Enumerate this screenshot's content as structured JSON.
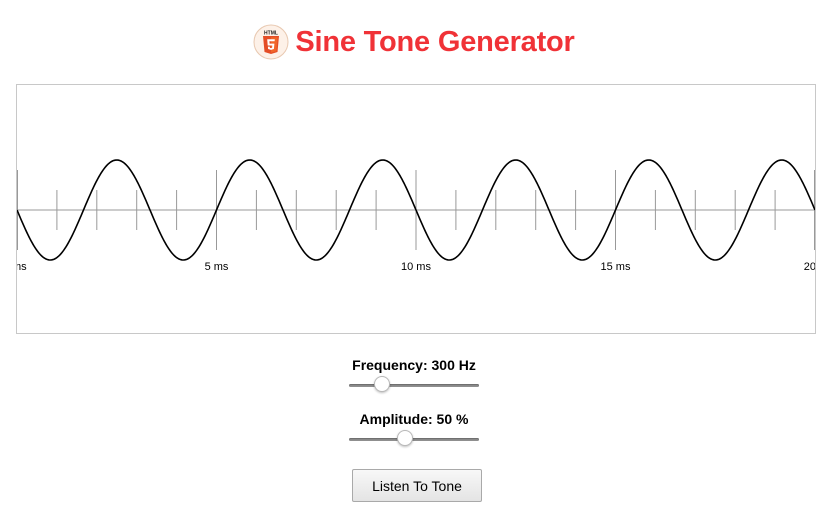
{
  "header": {
    "logo_icon": "html5-logo-icon",
    "logo_text": "HTML",
    "title": "Sine Tone Generator",
    "title_color": "#f03237"
  },
  "oscilloscope": {
    "time_labels": [
      "ms",
      "5 ms",
      "10 ms",
      "15 ms",
      "20"
    ],
    "visible_time_range_ms": [
      0,
      20
    ],
    "cycles_shown": 6
  },
  "frequency": {
    "label": "Frequency: 300 Hz",
    "value_hz": 300,
    "slider_fraction": 0.25
  },
  "amplitude": {
    "label": "Amplitude: 50 %",
    "value_percent": 50,
    "slider_fraction": 0.43
  },
  "listen_button": {
    "label": "Listen To Tone"
  }
}
